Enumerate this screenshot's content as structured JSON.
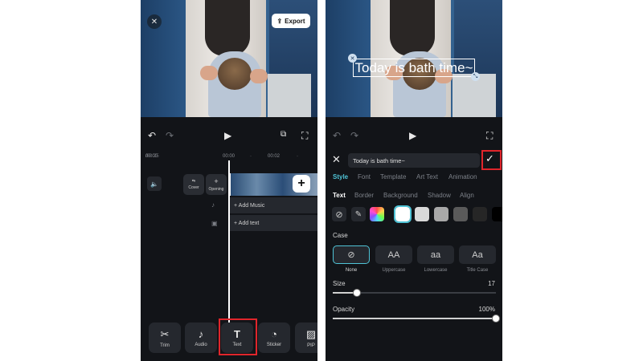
{
  "left": {
    "export_label": "Export",
    "time_current": "00:00",
    "time_total": "00:25",
    "ruler_mark_1": "00:00",
    "ruler_mark_2": "00:02",
    "ruler_dot": "·",
    "cover_label": "Cover",
    "opening_label": "Opening",
    "add_music_label": "+ Add Music",
    "add_text_label": "+ Add text",
    "tools": [
      {
        "label": "Trim",
        "icon": "scissors-icon"
      },
      {
        "label": "Audio",
        "icon": "music-note-icon"
      },
      {
        "label": "Text",
        "icon": "text-t-icon"
      },
      {
        "label": "Sticker",
        "icon": "sticker-icon"
      },
      {
        "label": "PIP",
        "icon": "pip-image-icon"
      }
    ],
    "highlight_color": "#e0252b"
  },
  "right": {
    "overlay_text": "Today is bath time~",
    "input_value": "Today is bath time~",
    "tabs": [
      "Style",
      "Font",
      "Template",
      "Art Text",
      "Animation"
    ],
    "active_tab": "Style",
    "subtabs": [
      "Text",
      "Border",
      "Background",
      "Shadow",
      "Align"
    ],
    "active_subtab": "Text",
    "swatch_colors": [
      "#ffffff",
      "#d9d9d9",
      "#a8a8a8",
      "#5a5a5a",
      "#262626",
      "#000000"
    ],
    "case_heading": "Case",
    "case_options": [
      {
        "glyph": "⊘",
        "label": "None"
      },
      {
        "glyph": "AA",
        "label": "Uppercase"
      },
      {
        "glyph": "aa",
        "label": "Lowercase"
      },
      {
        "glyph": "Aa",
        "label": "Title Case"
      }
    ],
    "size_label": "Size",
    "size_value": "17",
    "size_fraction": 0.15,
    "opacity_label": "Opacity",
    "opacity_value": "100%",
    "opacity_fraction": 1.0
  }
}
